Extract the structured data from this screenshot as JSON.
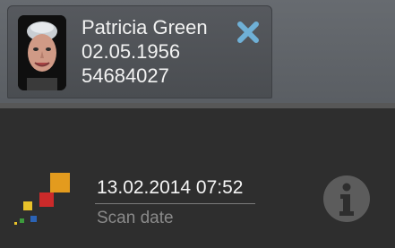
{
  "patient": {
    "name": "Patricia Green",
    "birth_date": "02.05.1956",
    "id": "54684027"
  },
  "scan": {
    "date": "13.02.2014 07:52",
    "label": "Scan date"
  },
  "icons": {
    "close": "close-x-icon",
    "info": "info-icon",
    "logo": "app-logo"
  },
  "colors": {
    "close_icon": "#6fb0d6",
    "logo_orange": "#e39b1e",
    "logo_red": "#cc2a2a",
    "logo_yellow": "#e8c22a",
    "logo_blue": "#2b63b5",
    "logo_green": "#3c9a3c"
  }
}
